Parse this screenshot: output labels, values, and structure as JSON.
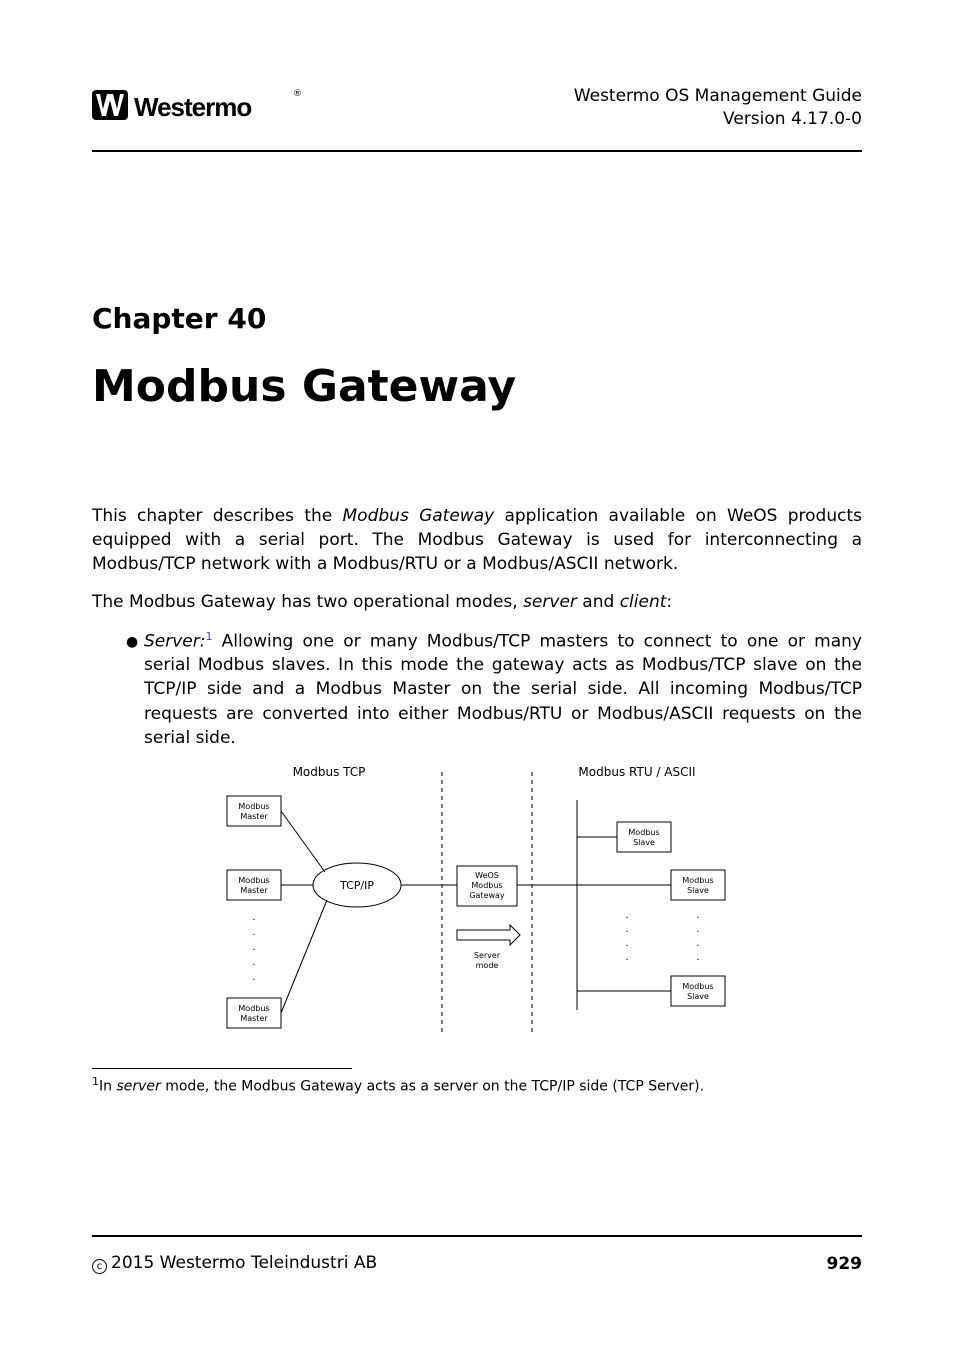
{
  "header": {
    "guide_title": "Westermo OS Management Guide",
    "version_line": "Version 4.17.0-0",
    "logo_text": "Westermo"
  },
  "chapter": {
    "label": "Chapter 40",
    "title": "Modbus Gateway"
  },
  "paragraphs": {
    "p1_a": "This chapter describes the ",
    "p1_i": "Modbus Gateway",
    "p1_b": " application available on WeOS products equipped with a serial port. The Modbus Gateway is used for interconnecting a Modbus/TCP network with a Modbus/RTU or a Modbus/ASCII network.",
    "p2_a": "The Modbus Gateway has two operational modes, ",
    "p2_i1": "server",
    "p2_b": " and ",
    "p2_i2": "client",
    "p2_c": ":"
  },
  "bullet1": {
    "label_italic": "Server:",
    "sup": "1",
    "text": "  Allowing one or many Modbus/TCP masters to connect to one or many serial Modbus slaves. In this mode the gateway acts as Modbus/TCP slave on the TCP/IP side and a Modbus Master on the serial side. All incoming Modbus/TCP requests are converted into either Modbus/RTU or Modbus/ASCII requests on the serial side."
  },
  "diagram": {
    "left_heading": "Modbus TCP",
    "right_heading": "Modbus RTU / ASCII",
    "master_label": "Modbus\nMaster",
    "tcpip_label": "TCP/IP",
    "gateway_label": "WeOS\nModbus\nGateway",
    "slave_label": "Modbus\nSlave",
    "mode_label": "Server\nmode"
  },
  "footnote": {
    "num": "1",
    "a": "In ",
    "i": "server",
    "b": " mode, the Modbus Gateway acts as a server on the TCP/IP side (TCP Server)."
  },
  "footer": {
    "copyright": "2015 Westermo Teleindustri AB",
    "page": "929",
    "c_symbol": "c"
  }
}
